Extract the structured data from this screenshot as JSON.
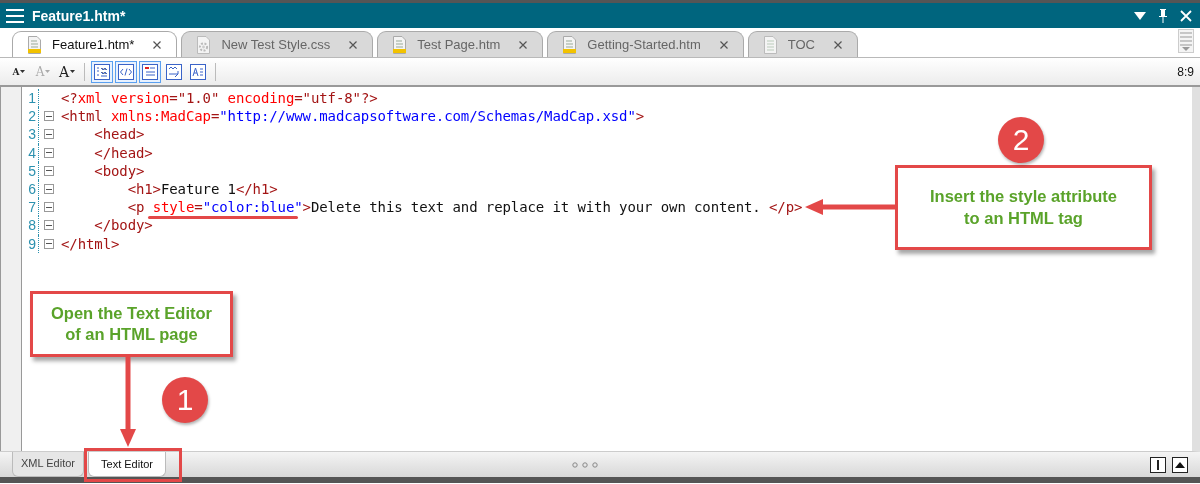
{
  "window": {
    "title": "Feature1.htm*"
  },
  "tabs": [
    {
      "label": "Feature1.htm*",
      "kind": "page",
      "selected": true
    },
    {
      "label": "New Test Style.css",
      "kind": "stylesheet",
      "selected": false
    },
    {
      "label": "Test Page.htm",
      "kind": "page",
      "selected": false
    },
    {
      "label": "Getting-Started.htm",
      "kind": "page",
      "selected": false
    },
    {
      "label": "TOC",
      "kind": "toc",
      "selected": false
    }
  ],
  "toolbar": {
    "buttons": [
      {
        "kind": "font-down",
        "label": "A",
        "on": false
      },
      {
        "kind": "font-reset",
        "label": "A",
        "on": false
      },
      {
        "kind": "font-up",
        "label": "A",
        "on": false
      },
      {
        "kind": "line-numbers",
        "on": true
      },
      {
        "kind": "tags",
        "on": true
      },
      {
        "kind": "outline",
        "on": true
      },
      {
        "kind": "wrap",
        "on": false
      },
      {
        "kind": "complete",
        "on": false
      }
    ],
    "position": "8:9"
  },
  "editor": {
    "lines": [
      {
        "number": "1",
        "fold": false,
        "segments": [
          {
            "kind": "tag",
            "text": "<?"
          },
          {
            "kind": "attr",
            "text": "xml version"
          },
          {
            "kind": "tag",
            "text": "=\"1.0\" "
          },
          {
            "kind": "attr",
            "text": "encoding"
          },
          {
            "kind": "tag",
            "text": "=\"utf-8\"?>"
          }
        ]
      },
      {
        "number": "2",
        "fold": true,
        "segments": [
          {
            "kind": "tag",
            "text": "<html"
          },
          {
            "kind": "attr",
            "text": " xmlns:MadCap"
          },
          {
            "kind": "tag",
            "text": "="
          },
          {
            "kind": "value",
            "text": "\"http://www.madcapsoftware.com/Schemas/MadCap.xsd\""
          },
          {
            "kind": "tag",
            "text": ">"
          }
        ]
      },
      {
        "number": "3",
        "fold": true,
        "segments": [
          {
            "kind": "tag",
            "text": "    <head>"
          }
        ]
      },
      {
        "number": "4",
        "fold": true,
        "segments": [
          {
            "kind": "tag",
            "text": "    </head>"
          }
        ]
      },
      {
        "number": "5",
        "fold": true,
        "segments": [
          {
            "kind": "tag",
            "text": "    <body>"
          }
        ]
      },
      {
        "number": "6",
        "fold": true,
        "segments": [
          {
            "kind": "tag",
            "text": "        <h1>"
          },
          {
            "kind": "text",
            "text": "Feature 1"
          },
          {
            "kind": "tag",
            "text": "</h1>"
          }
        ]
      },
      {
        "number": "7",
        "fold": true,
        "segments": [
          {
            "kind": "tag",
            "text": "        <p"
          },
          {
            "kind": "attr",
            "text": " style"
          },
          {
            "kind": "tag",
            "text": "="
          },
          {
            "kind": "value",
            "text": "\"color:blue\""
          },
          {
            "kind": "tag",
            "text": ">"
          },
          {
            "kind": "text",
            "text": "Delete this text and replace it with your own content. "
          },
          {
            "kind": "tag",
            "text": "</p>"
          }
        ]
      },
      {
        "number": "8",
        "fold": true,
        "segments": [
          {
            "kind": "tag",
            "text": "    </body>"
          }
        ]
      },
      {
        "number": "9",
        "fold": true,
        "segments": [
          {
            "kind": "tag",
            "text": "</html>"
          }
        ]
      }
    ]
  },
  "view_tabs": [
    {
      "label": "XML Editor",
      "selected": false
    },
    {
      "label": "Text Editor",
      "selected": true
    }
  ],
  "annotations": [
    {
      "kind": "underline"
    },
    {
      "kind": "callout",
      "number": "2",
      "text": "Insert the style attribute to an HTML tag"
    },
    {
      "kind": "callout",
      "number": "1",
      "text": "Open the Text Editor of an HTML page"
    },
    {
      "kind": "highlight"
    }
  ]
}
